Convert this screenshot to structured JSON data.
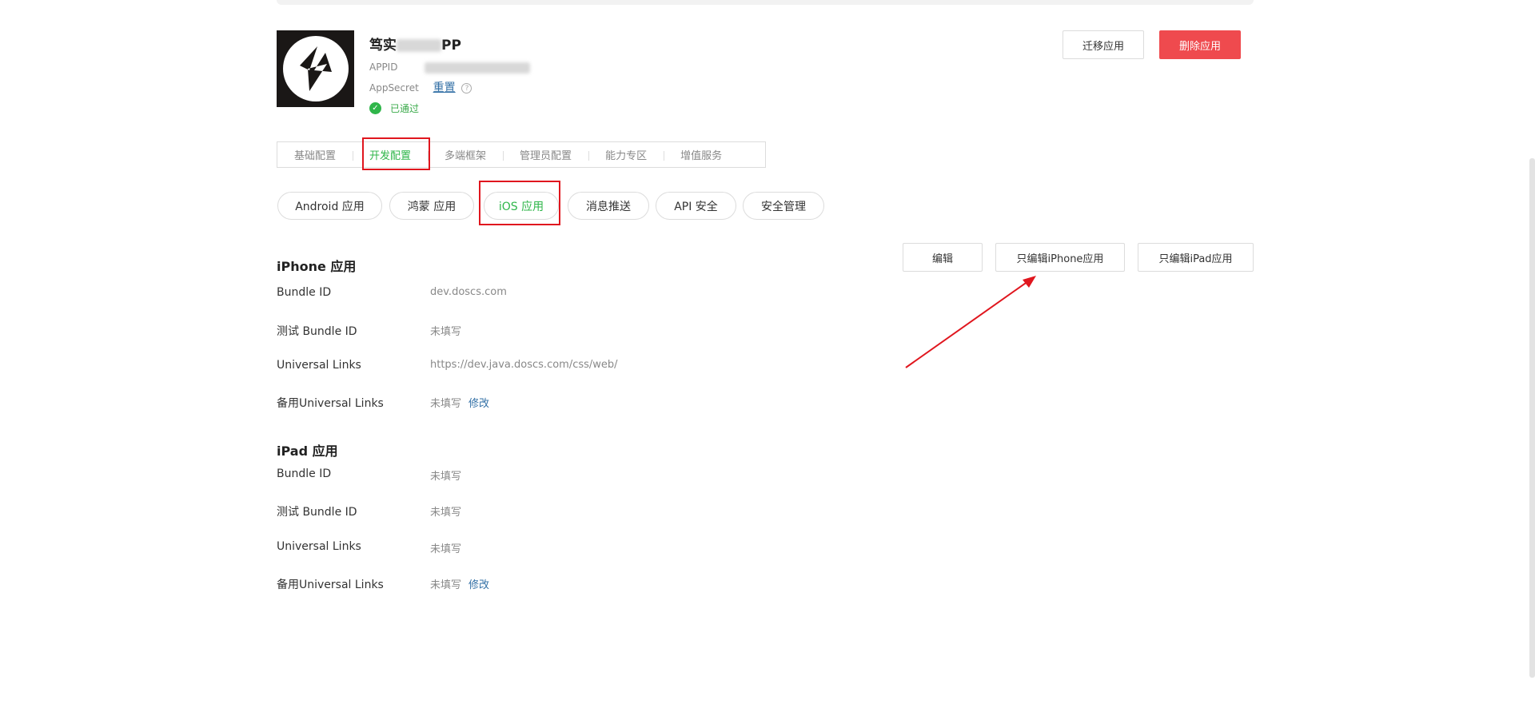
{
  "app": {
    "name_prefix": "笃实",
    "name_suffix": "PP",
    "appid_label": "APPID",
    "appsecret_label": "AppSecret",
    "reset_label": "重置",
    "help_icon": "?",
    "status_text": "已通过",
    "status_icon": "✓",
    "migrate_button": "迁移应用",
    "delete_button": "删除应用"
  },
  "main_tabs": [
    {
      "label": "基础配置"
    },
    {
      "label": "开发配置",
      "active": true
    },
    {
      "label": "多端框架"
    },
    {
      "label": "管理员配置"
    },
    {
      "label": "能力专区"
    },
    {
      "label": "增值服务"
    }
  ],
  "sub_tabs": [
    {
      "label": "Android 应用"
    },
    {
      "label": "鸿蒙 应用"
    },
    {
      "label": "iOS 应用",
      "active": true
    },
    {
      "label": "消息推送"
    },
    {
      "label": "API 安全"
    },
    {
      "label": "安全管理"
    }
  ],
  "actions": {
    "edit": "编辑",
    "edit_iphone": "只编辑iPhone应用",
    "edit_ipad": "只编辑iPad应用"
  },
  "iphone": {
    "title": "iPhone 应用",
    "rows": [
      {
        "label": "Bundle ID",
        "value": "dev.doscs.com"
      },
      {
        "label": "测试 Bundle ID",
        "value": "未填写"
      },
      {
        "label": "Universal Links",
        "value": "https://dev.java.doscs.com/css/web/"
      },
      {
        "label": "备用Universal Links",
        "value": "未填写",
        "edit": "修改"
      }
    ]
  },
  "ipad": {
    "title": "iPad 应用",
    "rows": [
      {
        "label": "Bundle ID",
        "value": "未填写"
      },
      {
        "label": "测试 Bundle ID",
        "value": "未填写"
      },
      {
        "label": "Universal Links",
        "value": "未填写"
      },
      {
        "label": "备用Universal Links",
        "value": "未填写",
        "edit": "修改"
      }
    ]
  },
  "colors": {
    "accent_green": "#2fb64a",
    "danger_red": "#ef4a4e",
    "annotation_red": "#e0161e",
    "link_blue": "#3370a6"
  }
}
